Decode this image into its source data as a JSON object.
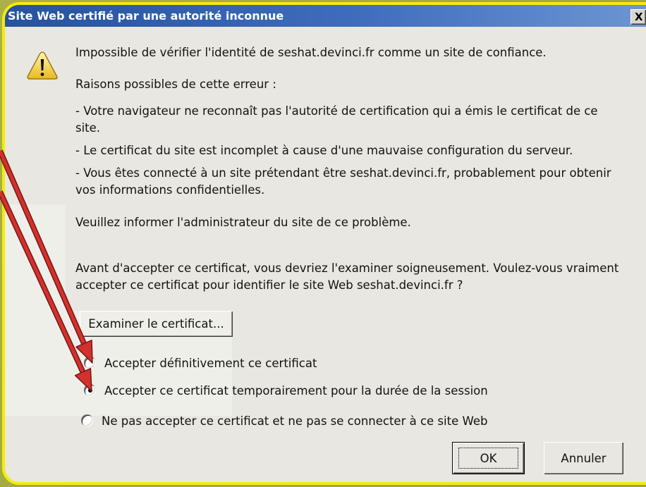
{
  "window": {
    "title": "Site Web certifié par une autorité inconnue",
    "close_label": "X"
  },
  "message": {
    "headline": "Impossible de vérifier l'identité de seshat.devinci.fr comme un site de confiance.",
    "reasons_heading": "Raisons possibles de cette erreur :",
    "reasons": [
      {
        "lines": [
          "- Votre navigateur ne reconnaît pas l'autorité de certification qui a émis le certificat de ce",
          "site."
        ]
      },
      {
        "lines": [
          "- Le certificat du site est incomplet à cause d'une mauvaise configuration du serveur."
        ]
      },
      {
        "lines": [
          "- Vous êtes connecté à un site prétendant être seshat.devinci.fr, probablement pour obtenir",
          "vos informations confidentielles."
        ]
      }
    ],
    "advice": "Veuillez informer l'administrateur du site de ce problème.",
    "question_lines": [
      "Avant d'accepter ce certificat, vous devriez l'examiner soigneusement. Voulez-vous vraiment",
      "accepter ce certificat pour identifier le site Web seshat.devinci.fr ?"
    ]
  },
  "examine_button": {
    "label": "Examiner le certificat..."
  },
  "options": [
    {
      "label": "Accepter définitivement ce certificat",
      "selected": false
    },
    {
      "label": "Accepter ce certificat temporairement pour la durée de la session",
      "selected": true
    },
    {
      "label": "Ne pas accepter ce certificat et ne pas se connecter à ce site Web",
      "selected": false
    }
  ],
  "actions": {
    "ok_label": "OK",
    "cancel_label": "Annuler"
  },
  "icons": {
    "message": "warning-icon",
    "close": "close-icon",
    "annotation": "arrow-icon"
  },
  "colors": {
    "backdrop": "#a6ab3d",
    "frame": "#f4ec0b",
    "dialog_background": "#e8e7e1",
    "title_bar": "#26529f",
    "title_text": "#ffffff",
    "annotation_arrow": "#d3312d"
  }
}
